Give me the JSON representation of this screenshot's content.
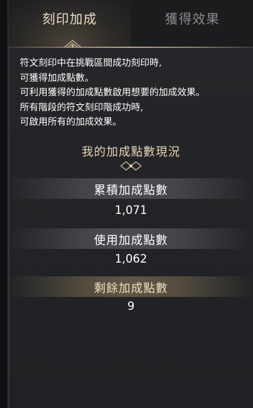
{
  "tabs": [
    {
      "label": "刻印加成",
      "active": true
    },
    {
      "label": "獲得效果",
      "active": false
    }
  ],
  "description": {
    "lines": [
      "符文刻印中在挑戰區間成功刻印時,",
      "可獲得加成點數。",
      "可利用獲得的加成點數啟用想要的加成效果。",
      "所有階段的符文刻印階成功時,",
      "可啟用所有的加成效果。"
    ]
  },
  "status": {
    "title": "我的加成點數現況",
    "accumulated": {
      "label": "累積加成點數",
      "value": "1,071"
    },
    "used": {
      "label": "使用加成點數",
      "value": "1,062"
    },
    "remaining": {
      "label": "剩餘加成點數",
      "value": "9"
    }
  },
  "colors": {
    "accent_gold": "#e6d6b4",
    "tab_inactive": "#8a8c8f",
    "panel_bg": "#222427"
  }
}
